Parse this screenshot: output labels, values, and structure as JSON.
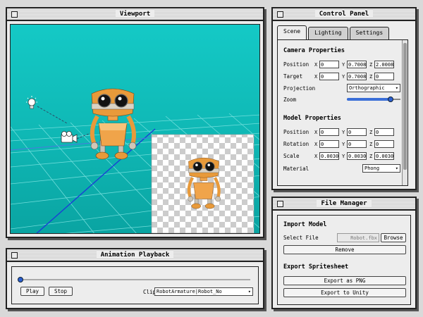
{
  "viewport": {
    "title": "Viewport"
  },
  "control_panel": {
    "title": "Control Panel",
    "tabs": [
      {
        "label": "Scene",
        "active": true
      },
      {
        "label": "Lighting",
        "active": false
      },
      {
        "label": "Settings",
        "active": false
      }
    ],
    "camera": {
      "heading": "Camera Properties",
      "position_label": "Position",
      "position": {
        "x": "0",
        "y": "0.7008",
        "z": "2.0008"
      },
      "target_label": "Target",
      "target": {
        "x": "0",
        "y": "0.7008",
        "z": "0"
      },
      "projection_label": "Projection",
      "projection": "Orthographic",
      "zoom_label": "Zoom",
      "zoom": 0.82
    },
    "model": {
      "heading": "Model Properties",
      "position_label": "Position",
      "position": {
        "x": "0",
        "y": "0",
        "z": "0"
      },
      "rotation_label": "Rotation",
      "rotation": {
        "x": "0",
        "y": "0",
        "z": "0"
      },
      "scale_label": "Scale",
      "scale": {
        "x": "0.0030",
        "y": "0.0030",
        "z": "0.0030"
      },
      "material_label": "Material",
      "material": "Phong"
    },
    "axis_labels": {
      "x": "X",
      "y": "Y",
      "z": "Z"
    }
  },
  "file_manager": {
    "title": "File Manager",
    "import_heading": "Import Model",
    "select_file_label": "Select File",
    "file_name": "Robot.fbx",
    "browse_label": "Browse",
    "remove_label": "Remove",
    "export_heading": "Export Spritesheet",
    "export_png_label": "Export as PNG",
    "export_unity_label": "Export to Unity"
  },
  "animation": {
    "title": "Animation Playback",
    "progress": 0.0,
    "play_label": "Play",
    "stop_label": "Stop",
    "clip_label": "Clip",
    "clip_value": "RobotArmature|Robot_No"
  },
  "colors": {
    "sky": "#14c9c6",
    "grid": "#7fe4e2",
    "axis_blue": "#1a3fd6",
    "robot_orange": "#e89a3a"
  }
}
